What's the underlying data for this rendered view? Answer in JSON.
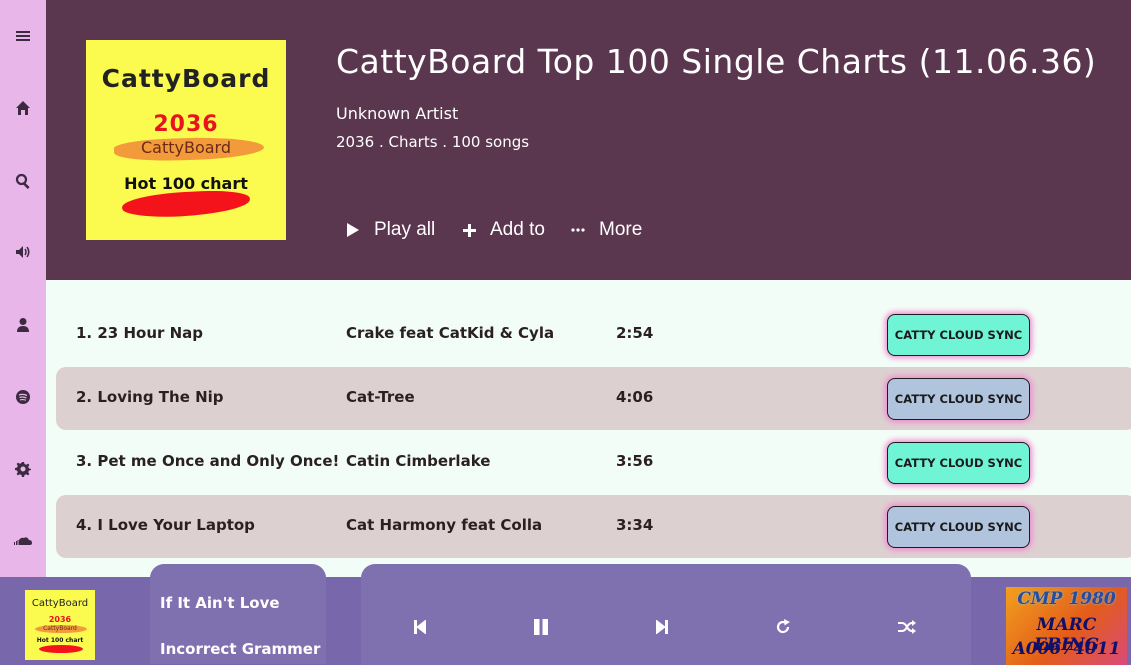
{
  "sidebar": {
    "icons": [
      "menu-icon",
      "home-icon",
      "search-icon",
      "volume-icon",
      "user-icon",
      "spotify-icon",
      "gear-icon",
      "soundcloud-icon"
    ]
  },
  "album": {
    "cover": {
      "title": "CattyBoard",
      "year": "2036",
      "brand": "CattyBoard",
      "subtitle": "Hot 100 chart"
    },
    "title": "CattyBoard Top 100 Single Charts (11.06.36)",
    "artist": "Unknown Artist",
    "meta": "2036 . Charts . 100 songs"
  },
  "actions": {
    "play_all": "Play all",
    "add_to": "Add to",
    "more": "More"
  },
  "tracks": [
    {
      "title": "1. 23 Hour Nap",
      "artist": "Crake feat CatKid & Cyla",
      "duration": "2:54",
      "sync": "CATTY CLOUD SYNC",
      "sync_color": "#6ff5d6"
    },
    {
      "title": "2. Loving The Nip",
      "artist": "Cat-Tree",
      "duration": "4:06",
      "sync": "CATTY CLOUD SYNC",
      "sync_color": "#b0c4de"
    },
    {
      "title": "3. Pet me Once and Only Once!",
      "artist": "Catin Cimberlake",
      "duration": "3:56",
      "sync": "CATTY CLOUD SYNC",
      "sync_color": "#6ff5d6"
    },
    {
      "title": "4. I Love Your Laptop",
      "artist": "Cat Harmony feat Colla",
      "duration": "3:34",
      "sync": "CATTY CLOUD SYNC",
      "sync_color": "#b0c4de"
    }
  ],
  "player": {
    "cover": {
      "title": "CattyBoard",
      "year": "2036",
      "brand": "CattyBoard",
      "subtitle": "Hot 100 chart"
    },
    "song": "If It Ain't Love",
    "artist": "Incorrect Grammer",
    "controls": [
      "previous-icon",
      "pause-icon",
      "next-icon",
      "repeat-icon",
      "shuffle-icon"
    ],
    "art2": {
      "line1": "CMP 1980",
      "line2": "MARC EBING",
      "line3": "A00674011"
    }
  },
  "colors": {
    "sidebar": "#e8b6e9",
    "header": "#5b364f",
    "list_bg": "#f3fdf7",
    "row_alt": "#ddd0d0",
    "player": "#7868ab"
  }
}
